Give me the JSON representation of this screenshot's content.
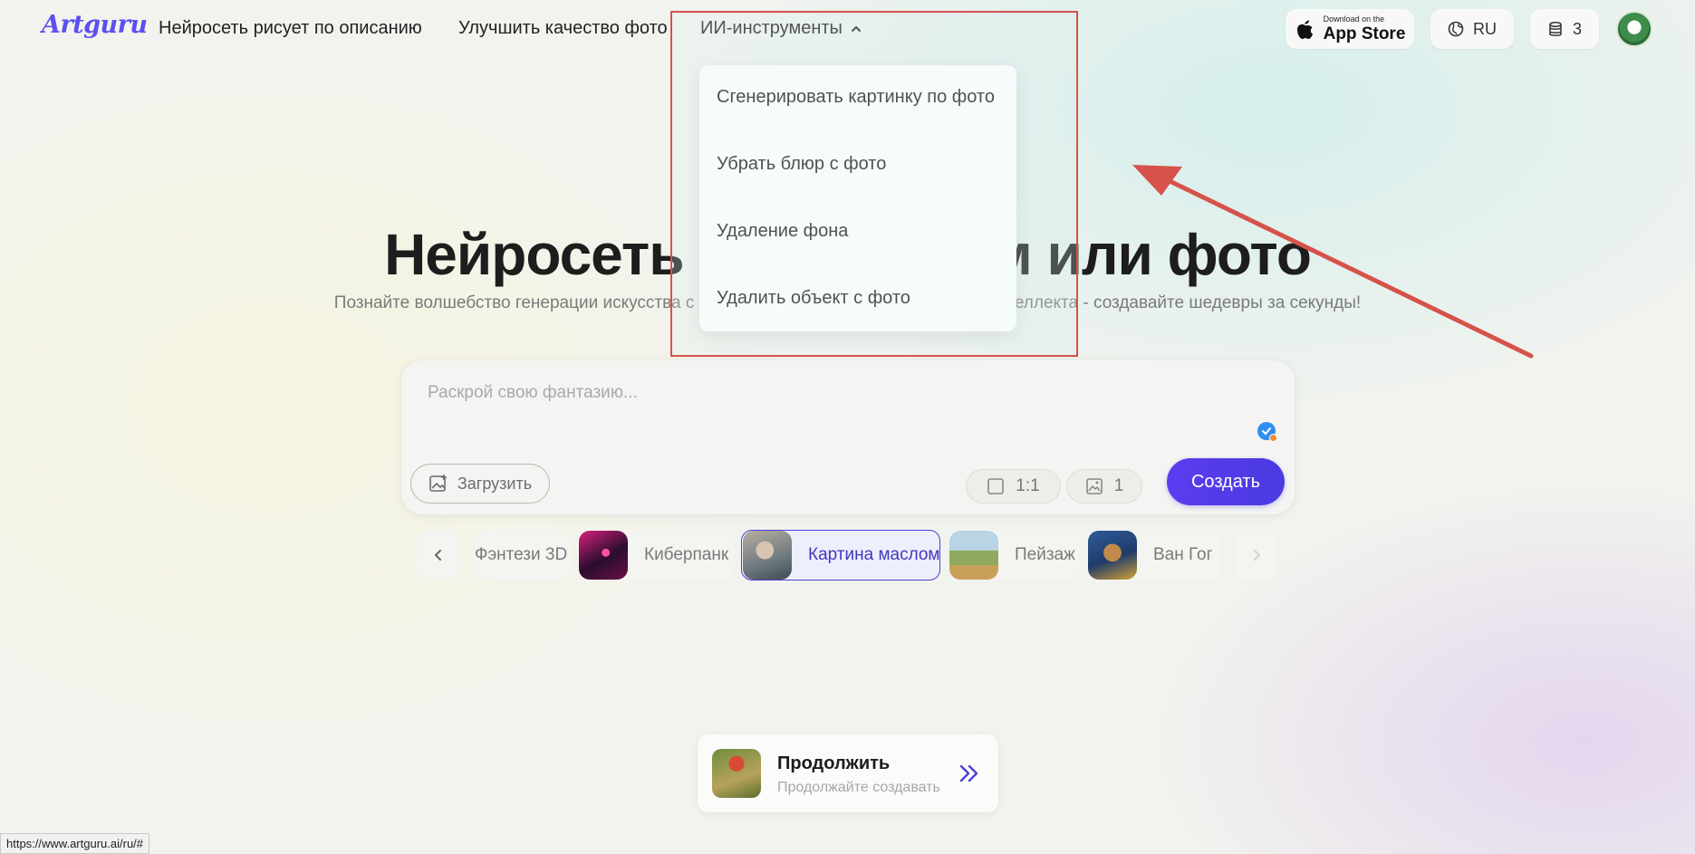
{
  "header": {
    "logo": "Artguru",
    "nav": {
      "text_to_image": "Нейросеть рисует по описанию",
      "enhance": "Улучшить качество фото",
      "ai_tools": "ИИ-инструменты"
    },
    "appstore": {
      "small": "Download on the",
      "big": "App Store"
    },
    "language": "RU",
    "credits": "3"
  },
  "dropdown": {
    "items": [
      "Сгенерировать картинку по фото",
      "Убрать блюр с фото",
      "Удаление фона",
      "Удалить объект с фото"
    ]
  },
  "annotation": {
    "box_color": "#d6524a",
    "arrow_color": "#d6524a"
  },
  "hero": {
    "title_left": "Нейросеть ри",
    "title_right": "ам или фото",
    "subtitle_left": "Познайте волшебство генерации искусства с",
    "subtitle_right": "теллекта - создавайте шедевры за секунды!"
  },
  "prompt": {
    "placeholder": "Раскрой свою фантазию...",
    "upload_label": "Загрузить",
    "ratio": "1:1",
    "count": "1",
    "create_label": "Создать"
  },
  "styles": {
    "items": [
      {
        "label": "Фэнтези 3D",
        "active": false
      },
      {
        "label": "Киберпанк",
        "active": false
      },
      {
        "label": "Картина маслом",
        "active": true
      },
      {
        "label": "Пейзаж",
        "active": false
      },
      {
        "label": "Ван Гог",
        "active": false
      }
    ]
  },
  "continue": {
    "title": "Продолжить",
    "subtitle": "Продолжайте создавать"
  },
  "statusbar": {
    "url": "https://www.artguru.ai/ru/#"
  },
  "colors": {
    "accent": "#5b3cf0",
    "brand": "#5b4ff0"
  }
}
